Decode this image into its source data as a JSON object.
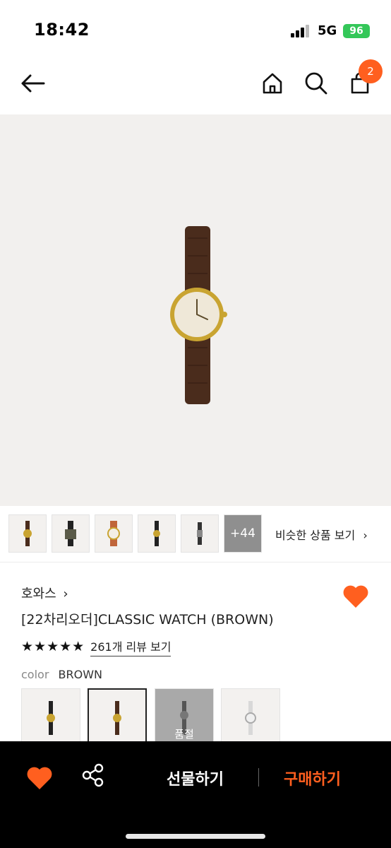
{
  "status": {
    "time": "18:42",
    "network": "5G",
    "battery": "96"
  },
  "nav": {
    "cart_count": "2"
  },
  "gallery": {
    "more_count": "+44",
    "similar_label": "비슷한 상품 보기"
  },
  "product": {
    "brand": "호와스",
    "title": "[22차리오더]CLASSIC WATCH (BROWN)",
    "stars": "★★★★★",
    "review_link": "261개 리뷰 보기",
    "color_label": "color",
    "color_value": "BROWN",
    "soldout_label": "품절"
  },
  "bottom_bar": {
    "gift_label": "선물하기",
    "buy_label": "구매하기"
  },
  "colors": {
    "accent": "#ff5f1f",
    "bar": "#000000",
    "battery": "#34c759"
  },
  "icons": [
    "back-arrow-icon",
    "home-icon",
    "search-icon",
    "cart-icon",
    "heart-icon",
    "share-icon",
    "chevron-right-icon"
  ]
}
